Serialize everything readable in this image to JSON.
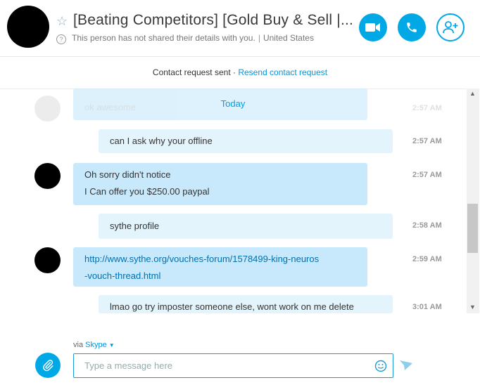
{
  "header": {
    "title": "[Beating Competitors] [Gold Buy & Sell |...",
    "status": "This person has not shared their details with you.",
    "location": "United States",
    "accent": "#00a8e6"
  },
  "request": {
    "text": "Contact request sent · ",
    "resend": "Resend contact request"
  },
  "conversation": {
    "day_label": "Today",
    "messages": [
      {
        "lines": [
          "ok awesome"
        ],
        "time": "2:57 AM"
      },
      {
        "lines": [
          "can I ask why your offline"
        ],
        "time": "2:57 AM"
      },
      {
        "lines": [
          "Oh sorry didn't notice",
          "I Can offer you $250.00 paypal"
        ],
        "time": "2:57 AM"
      },
      {
        "lines": [
          "sythe profile"
        ],
        "time": "2:58 AM"
      },
      {
        "lines": [
          "http://www.sythe.org/vouches-forum/1578499-king-neuros",
          "-vouch-thread.html"
        ],
        "time": "2:59 AM"
      },
      {
        "lines": [
          "lmao go try imposter someone else, wont work on me delete"
        ],
        "time": "3:01 AM"
      }
    ]
  },
  "composer": {
    "via": "via",
    "service": "Skype",
    "placeholder": "Type a message here"
  },
  "icons": [
    "star-icon",
    "help-icon",
    "video-call-icon",
    "phone-icon",
    "add-contact-icon",
    "paperclip-icon",
    "emoji-icon",
    "send-icon"
  ]
}
